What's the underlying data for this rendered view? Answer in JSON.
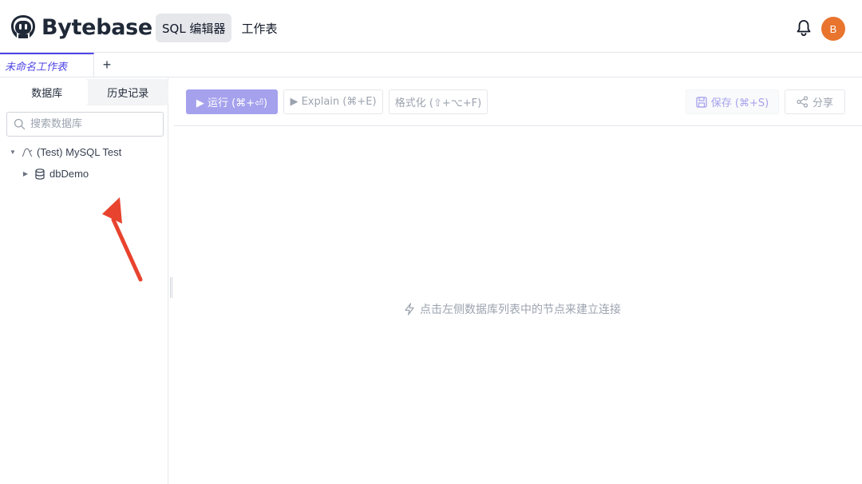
{
  "header": {
    "brand": "Bytebase",
    "nav": [
      {
        "label": "SQL 编辑器",
        "active": true
      },
      {
        "label": "工作表",
        "active": false
      }
    ],
    "avatar_initial": "B",
    "avatar_color": "#e8742e"
  },
  "tabs": {
    "sheet_tab_label": "未命名工作表",
    "add_label": "+"
  },
  "sidebar": {
    "tabs": [
      {
        "label": "数据库",
        "active": true
      },
      {
        "label": "历史记录",
        "active": false
      }
    ],
    "search_placeholder": "搜索数据库",
    "tree": [
      {
        "label": "(Test) MySQL Test",
        "icon": "instance-icon",
        "expanded": true,
        "depth": 0
      },
      {
        "label": "dbDemo",
        "icon": "database-icon",
        "expanded": false,
        "depth": 1
      }
    ]
  },
  "toolbar": {
    "run_label": "▶ 运行 (⌘+⏎)",
    "explain_label": "▶ Explain (⌘+E)",
    "format_label": "格式化 (⇧+⌥+F)",
    "save_label": "保存 (⌘+S)",
    "share_label": "分享"
  },
  "main": {
    "hint": "点击左侧数据库列表中的节点来建立连接"
  },
  "colors": {
    "accent": "#4f46e5",
    "run_button": "#a5a1ed",
    "annotation_arrow": "#e8432e"
  }
}
